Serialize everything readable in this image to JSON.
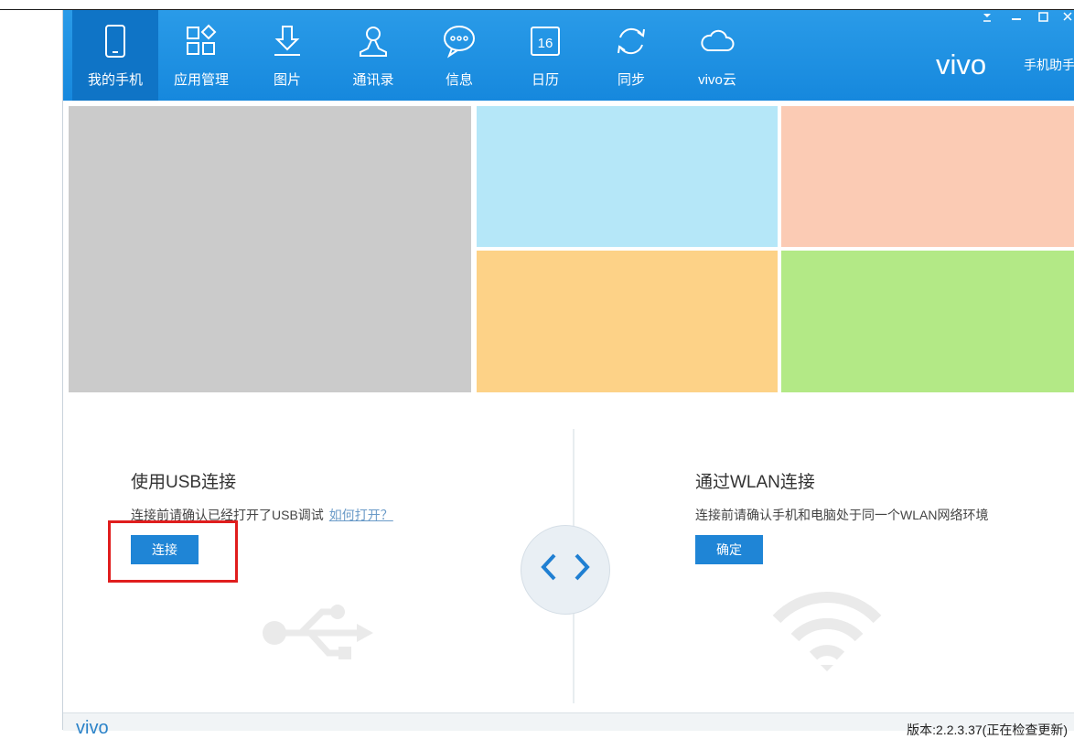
{
  "nav": {
    "items": [
      {
        "label": "我的手机",
        "icon": "phone-icon"
      },
      {
        "label": "应用管理",
        "icon": "apps-icon"
      },
      {
        "label": "图片",
        "icon": "download-icon"
      },
      {
        "label": "通讯录",
        "icon": "contacts-icon"
      },
      {
        "label": "信息",
        "icon": "message-icon"
      },
      {
        "label": "日历",
        "icon": "calendar-icon",
        "calendar_day": "16"
      },
      {
        "label": "同步",
        "icon": "sync-icon"
      },
      {
        "label": "vivo云",
        "icon": "cloud-icon"
      }
    ]
  },
  "brand": {
    "logo": "vivo",
    "subtitle": "手机助手"
  },
  "tiles": {
    "colors": {
      "gray": "#cbcbcb",
      "blue": "#b5e7f8",
      "salmon": "#fbcbb4",
      "orange": "#fdd287",
      "green": "#b3e986"
    }
  },
  "usb": {
    "title": "使用USB连接",
    "desc": "连接前请确认已经打开了USB调试",
    "help_link": "如何打开？",
    "button": "连接"
  },
  "wlan": {
    "title": "通过WLAN连接",
    "desc": "连接前请确认手机和电脑处于同一个WLAN网络环境",
    "button": "确定"
  },
  "footer": {
    "logo": "vivo",
    "version": "版本:2.2.3.37(正在检查更新)"
  },
  "colors": {
    "header": "#1a8ee0",
    "active_tab": "#0f74c6",
    "button": "#1f85d6",
    "highlight": "#e01d1d"
  }
}
